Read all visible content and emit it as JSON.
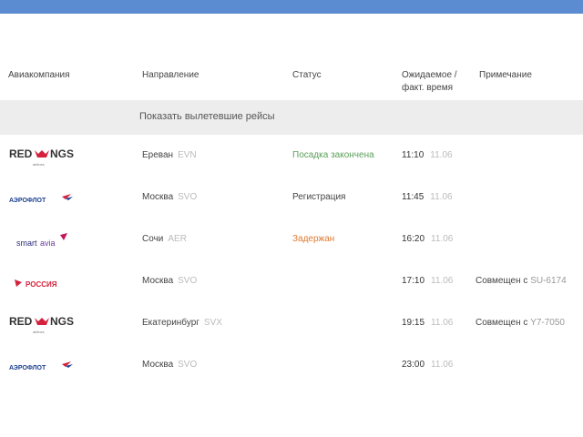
{
  "header": {
    "airline": "Авиакомпания",
    "direction": "Направление",
    "status": "Статус",
    "time_line1": "Ожидаемое /",
    "time_line2": "факт. время",
    "note": "Примечание"
  },
  "show_departed": "Показать вылетевшие рейсы",
  "colors": {
    "topbar": "#5b8bd0",
    "boarding_closed": "#5aa05a",
    "delayed": "#e07a30"
  },
  "flights": [
    {
      "airline": "RED WINGS",
      "logo_icon": "redwings-logo-icon",
      "city": "Ереван",
      "code": "EVN",
      "status": "Посадка закончена",
      "time": "11:10",
      "date": "11.06",
      "note_prefix": "",
      "note_flight": ""
    },
    {
      "airline": "АЭРОФЛОТ",
      "logo_icon": "aeroflot-logo-icon",
      "city": "Москва",
      "code": "SVO",
      "status": "Регистрация",
      "time": "11:45",
      "date": "11.06",
      "note_prefix": "",
      "note_flight": ""
    },
    {
      "airline": "smartavia",
      "logo_icon": "smartavia-logo-icon",
      "city": "Сочи",
      "code": "AER",
      "status": "Задержан",
      "time": "16:20",
      "date": "11.06",
      "note_prefix": "",
      "note_flight": ""
    },
    {
      "airline": "РОССИЯ",
      "logo_icon": "rossiya-logo-icon",
      "city": "Москва",
      "code": "SVO",
      "status": "",
      "time": "17:10",
      "date": "11.06",
      "note_prefix": "Совмещен с",
      "note_flight": "SU-6174"
    },
    {
      "airline": "RED WINGS",
      "logo_icon": "redwings-logo-icon",
      "city": "Екатеринбург",
      "code": "SVX",
      "status": "",
      "time": "19:15",
      "date": "11.06",
      "note_prefix": "Совмещен с",
      "note_flight": "Y7-7050"
    },
    {
      "airline": "АЭРОФЛОТ",
      "logo_icon": "aeroflot-logo-icon",
      "city": "Москва",
      "code": "SVO",
      "status": "",
      "time": "23:00",
      "date": "11.06",
      "note_prefix": "",
      "note_flight": ""
    }
  ]
}
